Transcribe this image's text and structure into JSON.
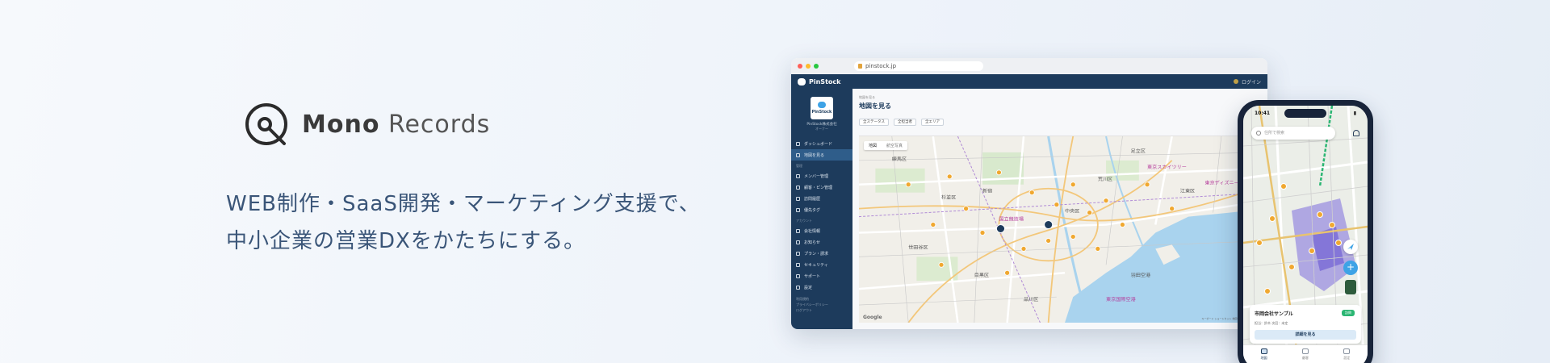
{
  "logo": {
    "bold": "Mono",
    "light": " Records"
  },
  "tagline": {
    "line1": "WEB制作・SaaS開発・マーケティング支援で、",
    "line2": "中小企業の営業DXをかたちにする。"
  },
  "browser": {
    "url": "pinstock.jp",
    "app_name": "PinStock",
    "user": "ログイン",
    "org_logo_name": "PinStock",
    "org_name": "PinStock株式会社",
    "org_role": "オーナー",
    "sidebar": {
      "top": [
        {
          "label": "ダッシュボード",
          "icon": "dashboard-icon"
        },
        {
          "label": "地図を見る",
          "icon": "map-icon",
          "active": true
        }
      ],
      "section_manage": "管理",
      "manage": [
        {
          "label": "メンバー管理",
          "icon": "users-icon"
        },
        {
          "label": "顧客・ピン管理",
          "icon": "pin-icon"
        },
        {
          "label": "訪問履歴",
          "icon": "history-icon"
        },
        {
          "label": "優先タグ",
          "icon": "tag-icon"
        }
      ],
      "section_account": "アカウント",
      "account": [
        {
          "label": "会社情報",
          "icon": "building-icon"
        },
        {
          "label": "お知らせ",
          "icon": "megaphone-icon"
        },
        {
          "label": "プラン・請求",
          "icon": "card-icon"
        },
        {
          "label": "セキュリティ",
          "icon": "lock-icon"
        },
        {
          "label": "サポート",
          "icon": "chat-icon"
        },
        {
          "label": "設定",
          "icon": "gear-icon"
        }
      ],
      "footer_lines": [
        "利用規約",
        "プライバシーポリシー",
        "ログアウト"
      ]
    },
    "breadcrumb": "地図を見る",
    "page_title": "地図を見る",
    "filters": [
      "全ステータス",
      "全担当者",
      "全エリア"
    ],
    "map_tabs": [
      "地図",
      "航空写真"
    ],
    "map_labels": [
      {
        "text": "練馬区",
        "color": "#555"
      },
      {
        "text": "杉並区",
        "color": "#555"
      },
      {
        "text": "世田谷区",
        "color": "#555"
      },
      {
        "text": "目黒区",
        "color": "#555"
      },
      {
        "text": "新宿",
        "color": "#555"
      },
      {
        "text": "足立区",
        "color": "#555"
      },
      {
        "text": "荒川区",
        "color": "#555"
      },
      {
        "text": "江東区",
        "color": "#555"
      },
      {
        "text": "中央区",
        "color": "#555"
      },
      {
        "text": "品川区",
        "color": "#555"
      },
      {
        "text": "東京ディズニーランド",
        "color": "#b4399a"
      },
      {
        "text": "羽田空港",
        "color": "#555"
      },
      {
        "text": "東京国際空港",
        "color": "#b4399a"
      },
      {
        "text": "国立競技場",
        "color": "#b4399a"
      },
      {
        "text": "東京スカイツリー",
        "color": "#b4399a"
      }
    ],
    "map_brand": "Google",
    "map_attribution": "キーボード ショートカット  地図データ ©2025  利用規約"
  },
  "phone": {
    "time": "10:41",
    "search_placeholder": "住所で検索",
    "card": {
      "title": "市岡会社サンプル",
      "badge": "訪問",
      "meta": "担当：鈴木  次回：未定",
      "button": "詳細を見る"
    },
    "tabs": [
      {
        "label": "地図",
        "icon": "map-icon",
        "active": true
      },
      {
        "label": "顧客",
        "icon": "person-icon"
      },
      {
        "label": "設定",
        "icon": "gear-icon"
      }
    ]
  },
  "colors": {
    "navy": "#1d3b5c",
    "accent": "#3ea3e6",
    "tagline": "#3a5578"
  }
}
